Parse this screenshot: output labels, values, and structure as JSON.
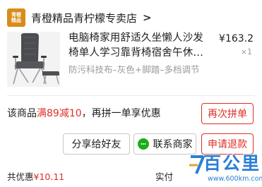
{
  "store": {
    "logo_text": "青橙\n精品",
    "name": "青橙精品青柠檬专卖店",
    "chevron": ">"
  },
  "product": {
    "title": "电脑椅家用舒适久坐懒人沙发椅单人学习靠背椅宿舍午休办公椅",
    "spec": "防污科技布–灰色+脚踏–多档调节",
    "price": "¥163.2",
    "quantity": "×1"
  },
  "promo": {
    "prefix": "该商品",
    "highlight": "满89减10",
    "suffix": "，再拼一单享优惠"
  },
  "buttons": {
    "rebuy": "再次拼单",
    "share": "分享给好友",
    "contact": "联系商家",
    "refund": "申请退款"
  },
  "summary": {
    "discount_label": "共优惠",
    "discount_amount": "¥10.11",
    "paid_label": "实付"
  },
  "watermark": {
    "brand": "百公里",
    "url": "www.600km.com"
  },
  "colors": {
    "accent_red": "#e02e24",
    "wechat_green": "#1aad19",
    "store_logo": "#d98c1a",
    "watermark_blue": "#2b7fd4"
  }
}
